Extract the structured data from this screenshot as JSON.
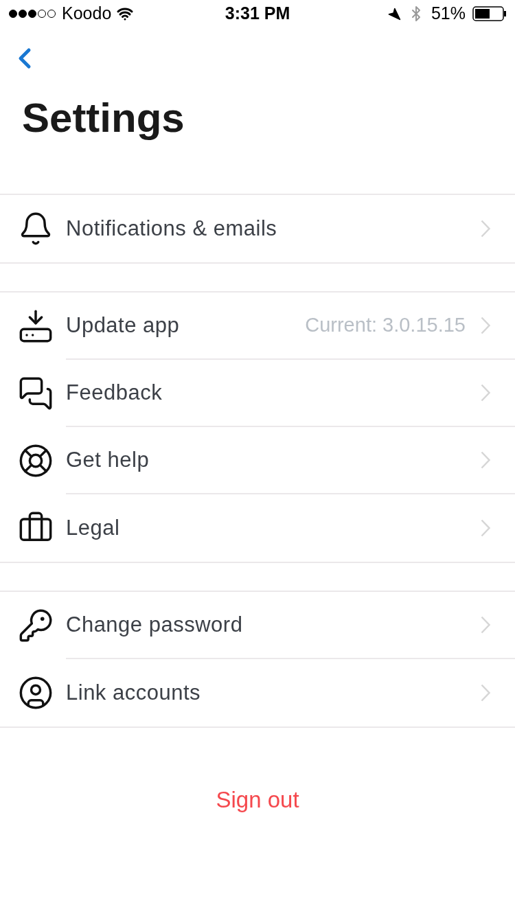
{
  "status_bar": {
    "carrier": "Koodo",
    "time": "3:31 PM",
    "battery": "51%"
  },
  "title": "Settings",
  "groups": [
    {
      "items": [
        {
          "label": "Notifications & emails"
        }
      ]
    },
    {
      "items": [
        {
          "label": "Update app",
          "detail": "Current: 3.0.15.15"
        },
        {
          "label": "Feedback"
        },
        {
          "label": "Get help"
        },
        {
          "label": "Legal"
        }
      ]
    },
    {
      "items": [
        {
          "label": "Change password"
        },
        {
          "label": "Link accounts"
        }
      ]
    }
  ],
  "sign_out": "Sign out"
}
